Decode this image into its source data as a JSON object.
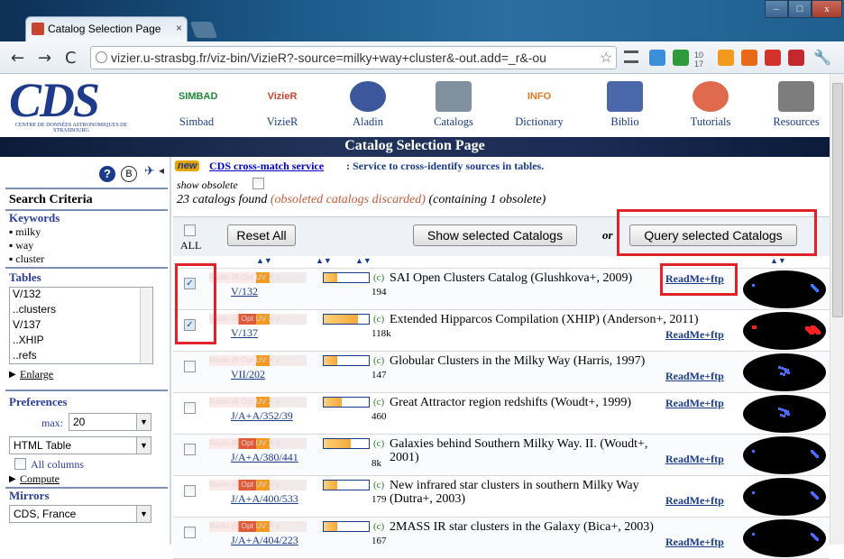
{
  "browser": {
    "tab_title": "Catalog Selection Page",
    "tab_close": "×",
    "url": "vizier.u-strasbg.fr/viz-bin/VizieR?-source=milky+way+cluster&-out.add=_r&-ou",
    "window_buttons": [
      "–",
      "□",
      "x"
    ],
    "ext_badge": "10 17"
  },
  "header": {
    "logo_text": "CDS",
    "logo_sub": "Centre de Données astronomiques de Strasbourg",
    "nav": [
      {
        "label": "Simbad",
        "icon": "simbad-icon",
        "logo": "SIMBAD"
      },
      {
        "label": "VizieR",
        "icon": "vizier-icon",
        "logo": "VizieR"
      },
      {
        "label": "Aladin",
        "icon": "aladin-icon"
      },
      {
        "label": "Catalogs",
        "icon": "catalogs-icon"
      },
      {
        "label": "Dictionary",
        "icon": "dictionary-icon",
        "logo": "INFO"
      },
      {
        "label": "Biblio",
        "icon": "biblio-icon"
      },
      {
        "label": "Tutorials",
        "icon": "tutorials-icon"
      },
      {
        "label": "Resources",
        "icon": "resources-icon"
      }
    ]
  },
  "banner": {
    "title": "Catalog Selection Page"
  },
  "sidebar": {
    "help_icon": "?",
    "b_icon": "B",
    "search_criteria": "Search Criteria",
    "keywords_label": "Keywords",
    "keywords": [
      "milky",
      "way",
      "cluster"
    ],
    "tables_label": "Tables",
    "tables": [
      "V/132",
      "..clusters",
      "V/137",
      "..XHIP",
      "..refs"
    ],
    "enlarge": "Enlarge",
    "preferences_label": "Preferences",
    "max_label": "max:",
    "max_value": "20",
    "format_value": "HTML Table",
    "all_columns": "All columns",
    "compute": "Compute",
    "mirrors_label": "Mirrors",
    "mirror_value": "CDS, France"
  },
  "main": {
    "new_badge": "new",
    "crossmatch_link": "CDS cross-match service",
    "crossmatch_desc": ": Service to cross-identify sources in tables.",
    "show_obsolete": "show obsolete",
    "found_count": "23 catalogs found",
    "found_obsoleted": "(obsoleted catalogs discarded)",
    "found_containing": "(containing 1 obsolete)",
    "all_label": "ALL",
    "reset_all": "Reset All",
    "show_selected": "Show selected Catalogs",
    "or_label": "or",
    "query_selected": "Query selected Catalogs",
    "readme": "ReadMe+ftp",
    "wavebands": "Radio IR Opt UV X γ",
    "catalogs": [
      {
        "id": "V/132",
        "count": "194",
        "title": "SAI Open Clusters Catalog (Glushkova+, 2009)",
        "checked": true,
        "fill": 0.3,
        "ir": false
      },
      {
        "id": "V/137",
        "count": "118k",
        "title": "Extended Hipparcos Compilation (XHIP) (Anderson+, 2011)",
        "checked": true,
        "fill": 0.75,
        "ir": true
      },
      {
        "id": "VII/202",
        "count": "147",
        "title": "Globular Clusters in the Milky Way (Harris, 1997)",
        "checked": false,
        "fill": 0.3,
        "ir": false
      },
      {
        "id": "J/A+A/352/39",
        "count": "460",
        "title": "Great Attractor region redshifts (Woudt+, 1999)",
        "checked": false,
        "fill": 0.4,
        "ir": false
      },
      {
        "id": "J/A+A/380/441",
        "count": "8k",
        "title": "Galaxies behind Southern Milky Way. II. (Woudt+, 2001)",
        "checked": false,
        "fill": 0.6,
        "ir": true
      },
      {
        "id": "J/A+A/400/533",
        "count": "179",
        "title": "New infrared star clusters in southern Milky Way (Dutra+, 2003)",
        "checked": false,
        "fill": 0.3,
        "ir": true
      },
      {
        "id": "J/A+A/404/223",
        "count": "167",
        "title": "2MASS IR star clusters in the Galaxy (Bica+, 2003)",
        "checked": false,
        "fill": 0.3,
        "ir": true
      }
    ]
  }
}
